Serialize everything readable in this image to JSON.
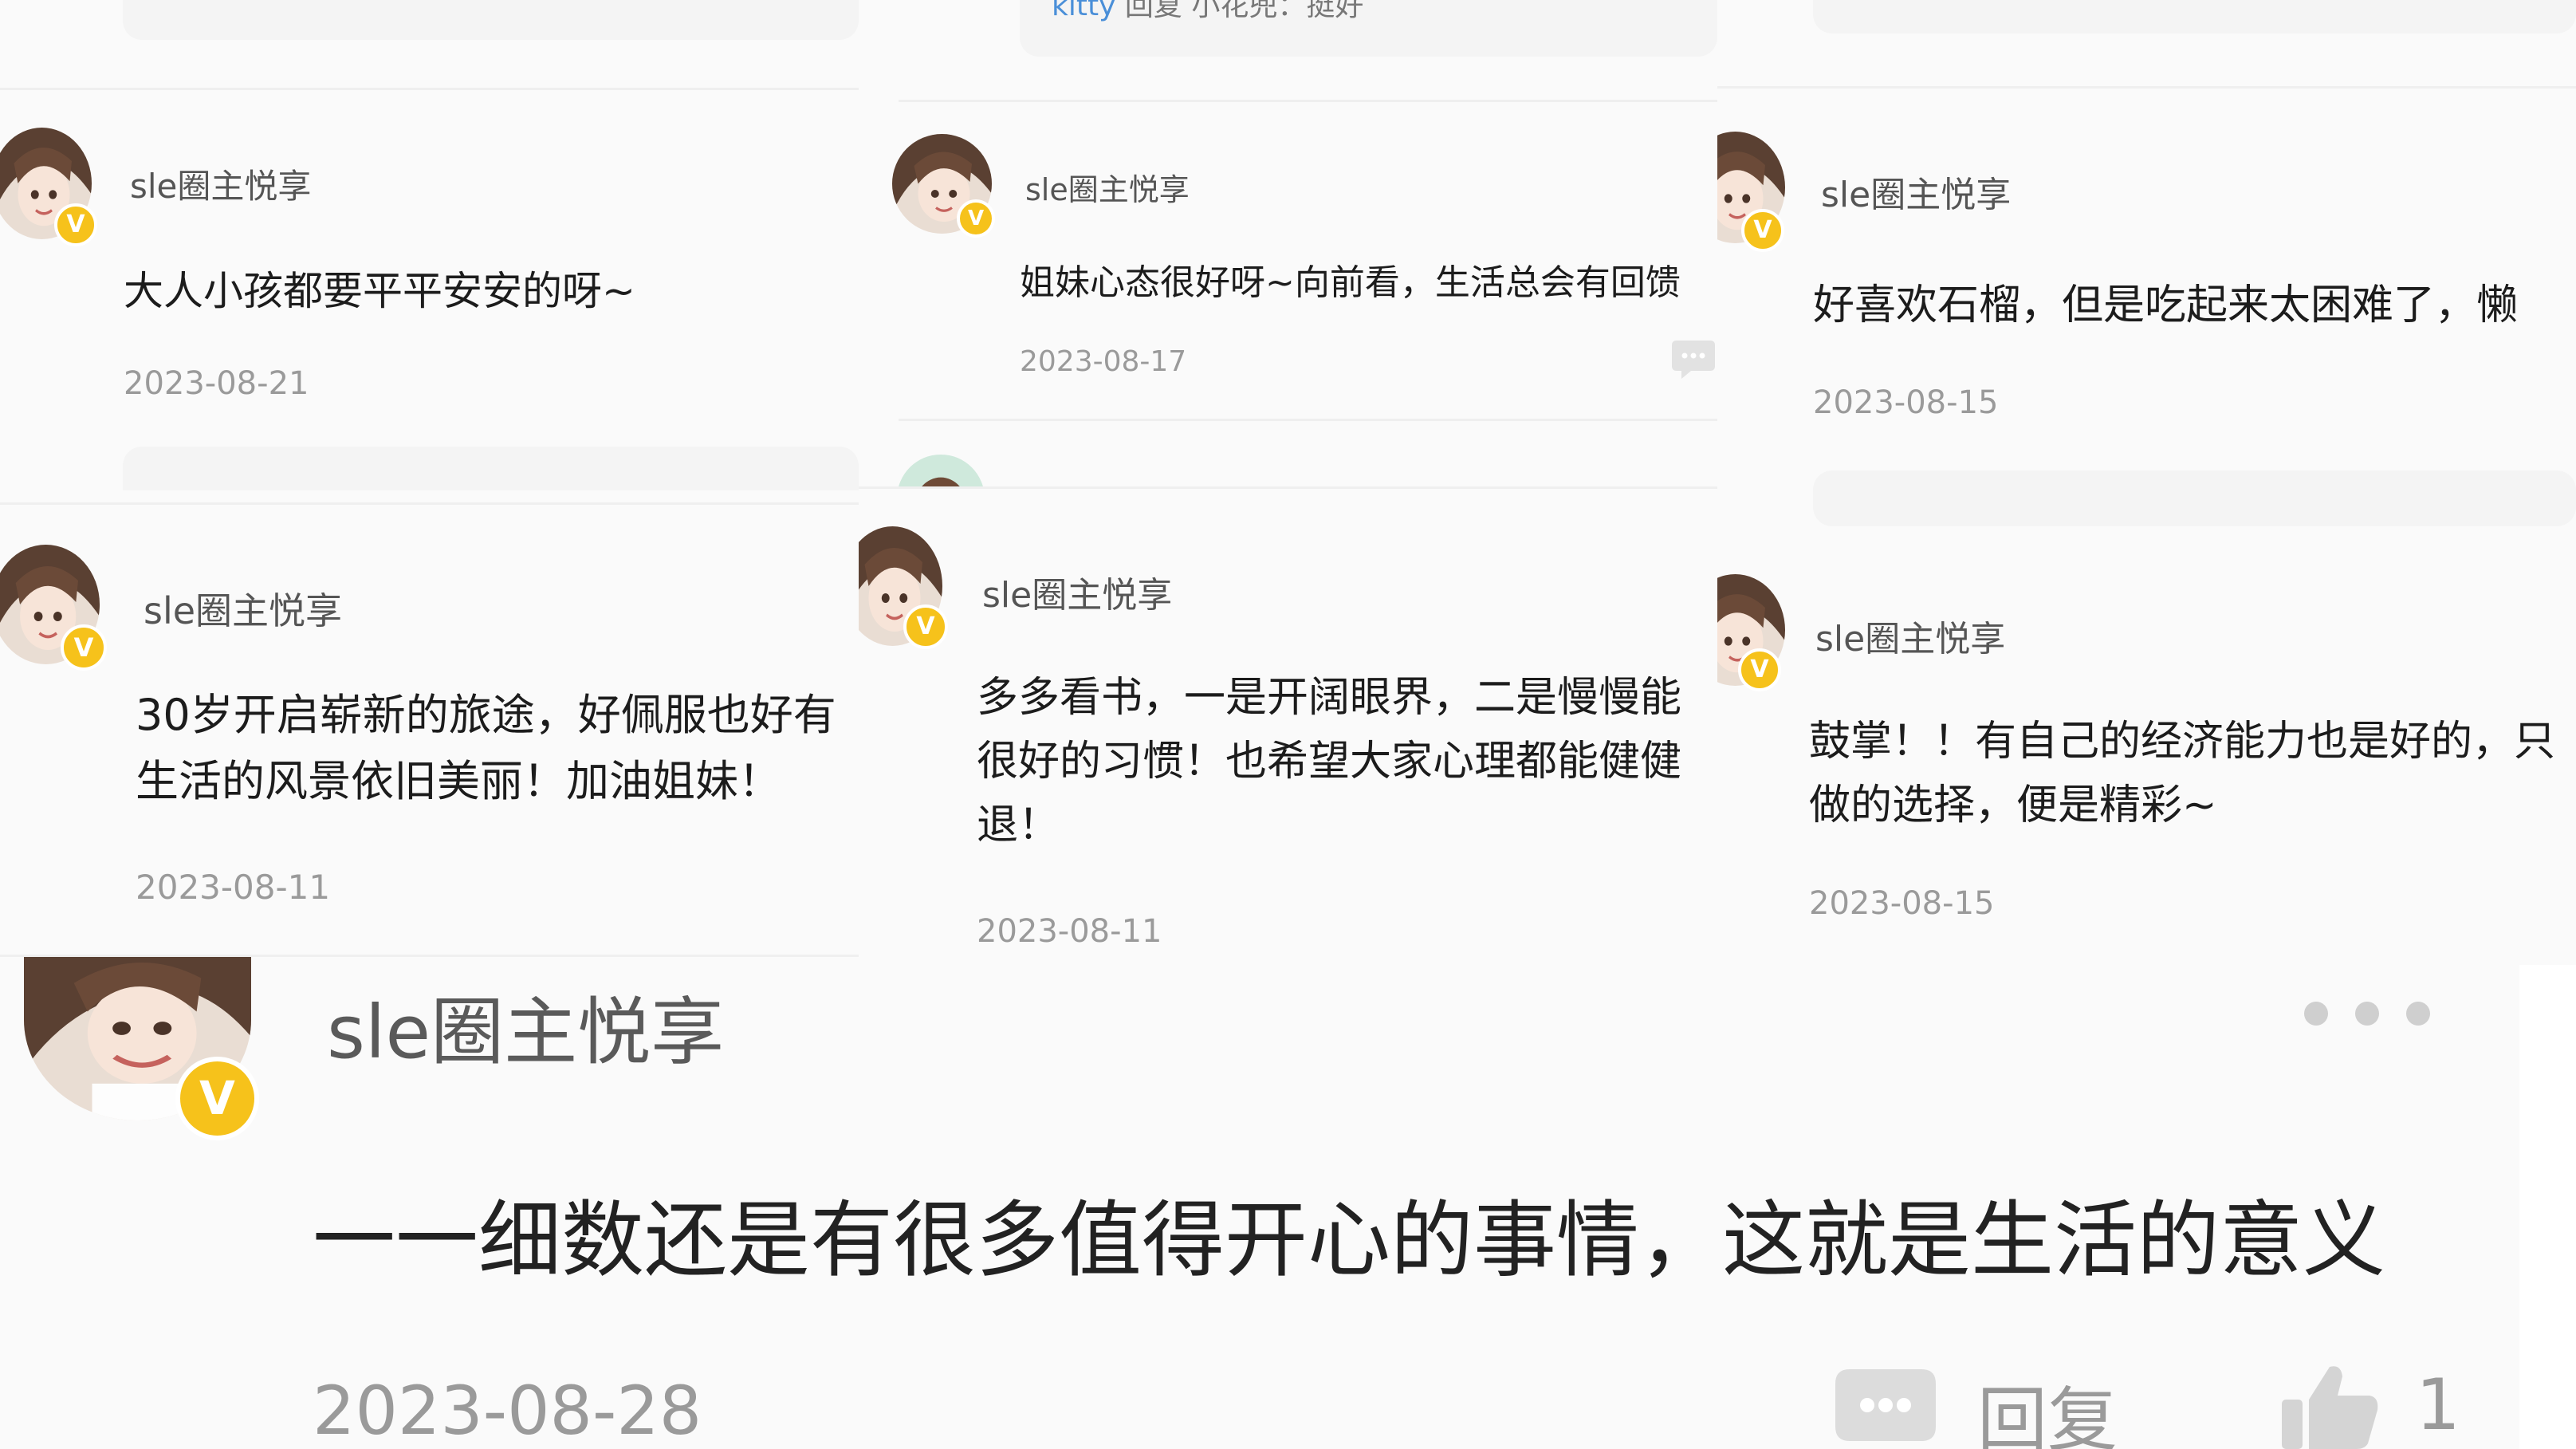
{
  "top_middle_reply": {
    "user": "kitty",
    "verb": "回复",
    "target": "小花兜",
    "text": "挺好"
  },
  "comments": [
    {
      "username": "sle圈主悦享",
      "lines": [
        "大人小孩都要平平安安的呀~"
      ],
      "date": "2023-08-21"
    },
    {
      "username": "sle圈主悦享",
      "lines": [
        "姐妹心态很好呀~向前看，生活总会有回馈"
      ],
      "date": "2023-08-17"
    },
    {
      "username": "sle圈主悦享",
      "lines": [
        "好喜欢石榴，但是吃起来太困难了，懒"
      ],
      "date": "2023-08-15"
    },
    {
      "username": "sle圈主悦享",
      "lines": [
        "30岁开启崭新的旅途，好佩服也好有",
        "生活的风景依旧美丽！加油姐妹！"
      ],
      "date": "2023-08-11"
    },
    {
      "username": "sle圈主悦享",
      "lines": [
        "多多看书，一是开阔眼界，二是慢慢能",
        "很好的习惯！也希望大家心理都能健健",
        "退！"
      ],
      "date": "2023-08-11"
    },
    {
      "username": "sle圈主悦享",
      "lines": [
        "鼓掌！！有自己的经济能力也是好的，只",
        "做的选择，便是精彩~"
      ],
      "date": "2023-08-15"
    }
  ],
  "featured_comment": {
    "username": "sle圈主悦享",
    "text": "一一细数还是有很多值得开心的事情，这就是生活的意义",
    "date": "2023-08-28",
    "reply_label": "回复",
    "like_count": "1"
  },
  "badge_letter": "V",
  "icons": [
    "verified-badge-icon",
    "comment-bubble-icon",
    "more-dots-icon",
    "thumbs-up-icon"
  ],
  "colors": {
    "badge": "#f6c21b",
    "link_blue": "#4a8fd8",
    "date_gray": "#9a9a9a",
    "username_gray": "#555555"
  }
}
